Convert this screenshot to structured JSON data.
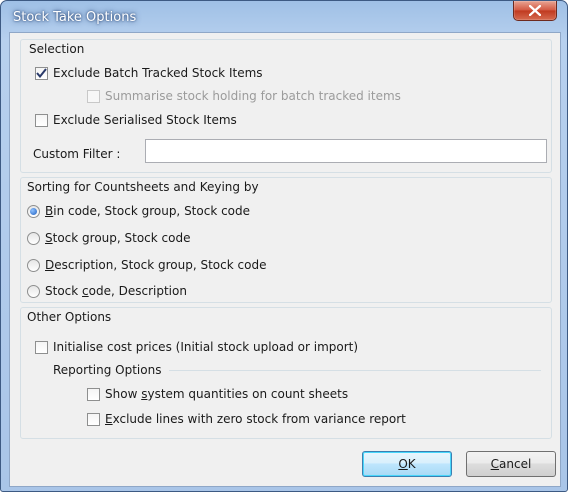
{
  "window": {
    "title": "Stock Take Options"
  },
  "selection": {
    "title": "Selection",
    "exclude_batch": {
      "label": "Exclude Batch Tracked Stock Items",
      "checked": true
    },
    "summarise_batch": {
      "label": "Summarise stock holding for batch tracked items",
      "checked": false,
      "enabled": false
    },
    "exclude_serialised": {
      "label": "Exclude Serialised Stock Items",
      "checked": false
    },
    "custom_filter": {
      "label": "Custom Filter :",
      "value": ""
    }
  },
  "sorting": {
    "title": "Sorting for Countsheets and Keying by",
    "options": [
      {
        "accel": "B",
        "rest": "in code, Stock group, Stock code",
        "selected": true
      },
      {
        "accel": "S",
        "rest": "tock group, Stock code",
        "selected": false
      },
      {
        "accel": "D",
        "rest": "escription, Stock group, Stock code",
        "selected": false
      },
      {
        "pre": "Stock ",
        "accel": "c",
        "rest": "ode, Description",
        "selected": false
      }
    ]
  },
  "other": {
    "title": "Other Options",
    "initialise_cost": {
      "label": "Initialise cost prices (Initial stock upload or import)",
      "checked": false
    },
    "reporting_title": "Reporting Options",
    "show_system_qty": {
      "pre": "Show ",
      "accel": "s",
      "rest": "ystem quantities on count sheets",
      "checked": false
    },
    "exclude_zero": {
      "accel": "E",
      "rest": "xclude lines with zero stock from variance report",
      "checked": false
    }
  },
  "buttons": {
    "ok": {
      "accel": "O",
      "rest": "K"
    },
    "cancel": {
      "accel": "C",
      "rest": "ancel"
    }
  },
  "colors": {
    "title_bar": "#a9c5e8",
    "close_button": "#c0391f",
    "radio_selected": "#1f5fbf"
  }
}
